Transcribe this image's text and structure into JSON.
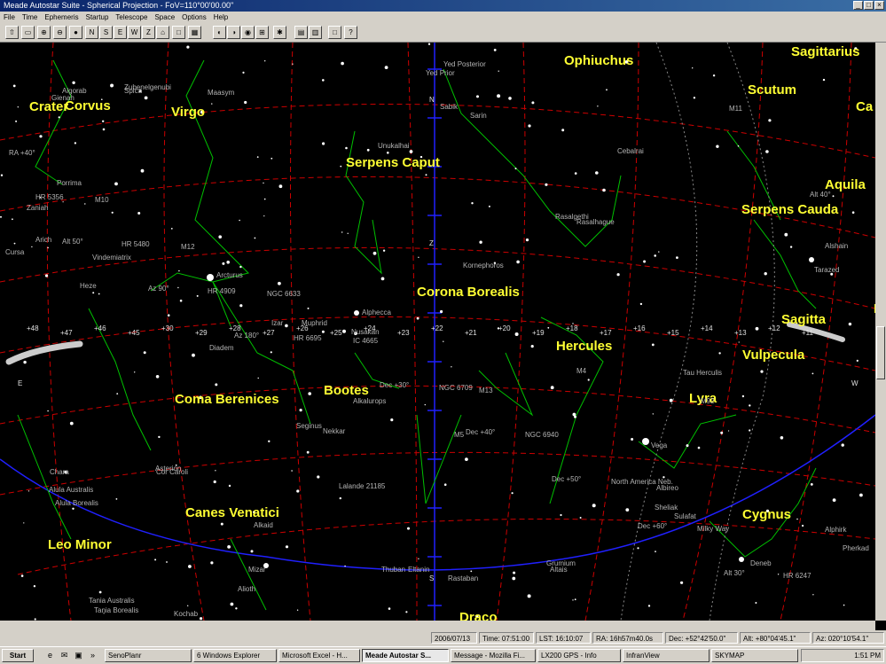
{
  "window": {
    "title": "Meade Autostar Suite - Spherical Projection - FoV=110°00'00.00\""
  },
  "menu": [
    "File",
    "Time",
    "Ephemeris",
    "Startup",
    "Telescope",
    "Space",
    "Options",
    "Help"
  ],
  "chart": {
    "constellations": [
      "Ophiuchus",
      "Sagittarius",
      "Scutum",
      "Crater",
      "Corvus",
      "Virgo",
      "Serpens Caput",
      "Aquila",
      "Serpens Cauda",
      "Corona Borealis",
      "Sagitta",
      "Hercules",
      "Vulpecula",
      "Bootes",
      "Coma Berenices",
      "Lyra",
      "Canes Venatici",
      "Cygnus",
      "Leo Minor",
      "Draco",
      "Ca",
      "D"
    ],
    "stars": [
      "Tau Herculis",
      "Arcturus",
      "Alphecca",
      "Nusakan",
      "Rasalgethi",
      "Kornephoros",
      "Sabik",
      "Zubenelgenubi",
      "Alkalurops",
      "Vega",
      "Alkaid",
      "Mizar",
      "Alioth",
      "Cor Caroli",
      "Thuban",
      "Alshain",
      "Tarazed",
      "Deneb",
      "Kochab",
      "Unukalhai",
      "Yed Posterior",
      "Yed Prior",
      "Sarin",
      "Spica",
      "Porrima",
      "Zaniah",
      "Vindemiatrix",
      "Diadem",
      "Alula Australis",
      "Alula Borealis",
      "Tania Australis",
      "Tania Borealis",
      "Algorab",
      "Gienah",
      "Nekkar",
      "Seginus",
      "Maasym",
      "Cebalrai",
      "Izar",
      "M13",
      "M5",
      "M4",
      "M92",
      "M11",
      "Albireo",
      "Sheliak",
      "Sulafat",
      "Alphirk",
      "Pherkad",
      "Eltanin",
      "Rastaban",
      "Altais",
      "Grumium",
      "Rasalhague",
      "Lalande 21185",
      "Asterion",
      "Chara",
      "Muphrid",
      "Arich",
      "Cursa",
      "Heze"
    ],
    "ra_labels": [
      "+48",
      "+47",
      "+46",
      "+45",
      "+30",
      "+29",
      "+28",
      "+27",
      "+26",
      "+25",
      "+24",
      "+23",
      "+22",
      "+21",
      "+20",
      "+19",
      "+18",
      "+17",
      "+16",
      "+15",
      "+14",
      "+13",
      "+12",
      "+11"
    ],
    "cardinal_labels": [
      "N",
      "S",
      "E",
      "W",
      "Z"
    ],
    "extra_labels": [
      "RA +40°",
      "M10",
      "M12",
      "NGC 6633",
      "IC 4665",
      "NGC 6709",
      "NGC 6940",
      "North America Neb.",
      "Milky Way",
      "HR 6247",
      "HR 5356",
      "HR 5480",
      "HR 4909",
      "HR 6695",
      "Dec +30°",
      "Dec +40°",
      "Dec +50°",
      "Dec +60°",
      "Alt 30°",
      "Alt 40°",
      "Alt 50°",
      "Az 90°",
      "Az 180°"
    ]
  },
  "status": [
    "2006/07/13",
    "Time: 07:51:00",
    "LST: 16:10:07",
    "RA: 16h57m40.0s",
    "Dec: +52°42'50.0\"",
    "Alt: +80°04'45.1\"",
    "Az: 020°10'54.1\""
  ],
  "taskbar": {
    "start": "Start",
    "tasks": [
      "SenoPlanr",
      "6 Windows Explorer",
      "Microsoft Excel - H...",
      "Meade Autostar S...",
      "Message - Mozilla Fi...",
      "LX200 GPS - Info",
      "InfranView",
      "SKYMAP"
    ],
    "clock": "1:51 PM"
  },
  "colors": {
    "constellation_label": "#ffff33",
    "constellation_line": "#00c000",
    "grid": "#cc0000",
    "ecliptic": "#2020ff",
    "meridian": "#2020ff"
  }
}
